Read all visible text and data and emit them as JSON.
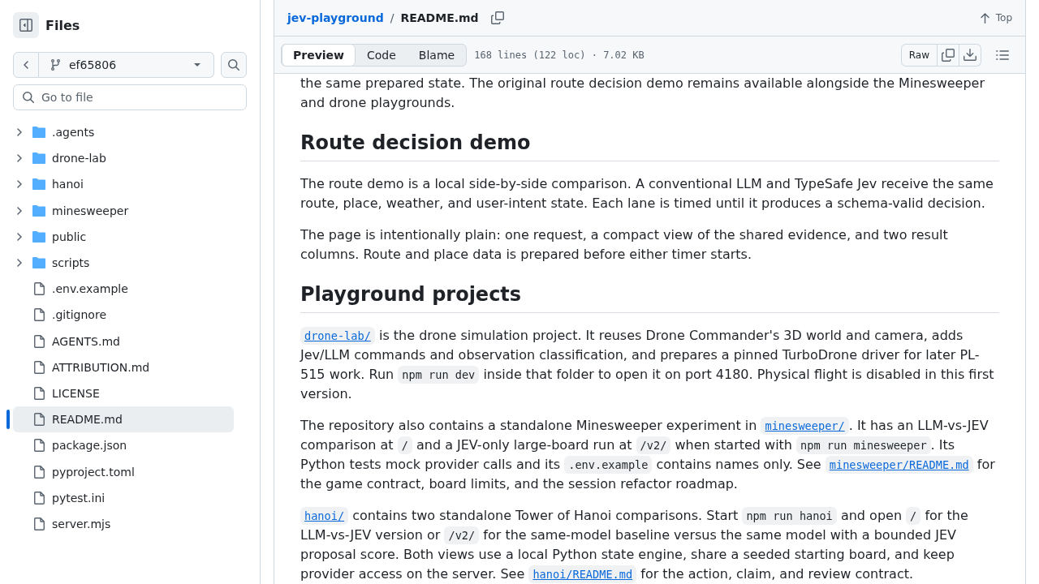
{
  "sidebar": {
    "title": "Files",
    "branch": "ef65806",
    "search": {
      "placeholder": "Go to file"
    },
    "tree": [
      {
        "name": ".agents",
        "kind": "folder",
        "expanded": false,
        "selected": false
      },
      {
        "name": "drone-lab",
        "kind": "folder",
        "expanded": false,
        "selected": false
      },
      {
        "name": "hanoi",
        "kind": "folder",
        "expanded": false,
        "selected": false
      },
      {
        "name": "minesweeper",
        "kind": "folder",
        "expanded": false,
        "selected": false
      },
      {
        "name": "public",
        "kind": "folder",
        "expanded": false,
        "selected": false
      },
      {
        "name": "scripts",
        "kind": "folder",
        "expanded": false,
        "selected": false
      },
      {
        "name": ".env.example",
        "kind": "file",
        "selected": false
      },
      {
        "name": ".gitignore",
        "kind": "file",
        "selected": false
      },
      {
        "name": "AGENTS.md",
        "kind": "file",
        "selected": false
      },
      {
        "name": "ATTRIBUTION.md",
        "kind": "file",
        "selected": false
      },
      {
        "name": "LICENSE",
        "kind": "file",
        "selected": false
      },
      {
        "name": "README.md",
        "kind": "file",
        "selected": true
      },
      {
        "name": "package.json",
        "kind": "file",
        "selected": false
      },
      {
        "name": "pyproject.toml",
        "kind": "file",
        "selected": false
      },
      {
        "name": "pytest.ini",
        "kind": "file",
        "selected": false
      },
      {
        "name": "server.mjs",
        "kind": "file",
        "selected": false
      }
    ]
  },
  "file": {
    "breadcrumb": {
      "repo": "jev-playground",
      "separator": "/",
      "file": "README.md"
    },
    "top": "Top",
    "view_tabs": [
      {
        "label": "Preview",
        "selected": true
      },
      {
        "label": "Code",
        "selected": false
      },
      {
        "label": "Blame",
        "selected": false
      }
    ],
    "stats": "168 lines (122 loc) · 7.02 KB",
    "raw": "Raw"
  },
  "readme": [
    {
      "kind": "paragraph",
      "parts": [
        {
          "kind": "text",
          "text": "the same prepared state. The original route decision demo remains available alongside the Minesweeper and drone playgrounds."
        }
      ]
    },
    {
      "kind": "heading",
      "text": "Route decision demo"
    },
    {
      "kind": "paragraph",
      "parts": [
        {
          "kind": "text",
          "text": "The route demo is a local side-by-side comparison. A conventional LLM and TypeSafe Jev receive the same route, place, weather, and user-intent state. Each lane is timed until it produces a schema-valid decision."
        }
      ]
    },
    {
      "kind": "paragraph",
      "parts": [
        {
          "kind": "text",
          "text": "The page is intentionally plain: one request, a compact view of the shared evidence, and two result columns. Route and place data is prepared before either timer starts."
        }
      ]
    },
    {
      "kind": "heading",
      "text": "Playground projects"
    },
    {
      "kind": "paragraph",
      "parts": [
        {
          "kind": "link",
          "text": "drone-lab/"
        },
        {
          "kind": "text",
          "text": " is the drone simulation project. It reuses Drone Commander's 3D world and camera, adds Jev/LLM commands and observation classification, and prepares a pinned TurboDrone driver for later PL-515 work. Run "
        },
        {
          "kind": "code",
          "text": "npm run dev"
        },
        {
          "kind": "text",
          "text": " inside that folder to open it on port 4180. Physical flight is disabled in this first version."
        }
      ]
    },
    {
      "kind": "paragraph",
      "parts": [
        {
          "kind": "text",
          "text": "The repository also contains a standalone Minesweeper experiment in "
        },
        {
          "kind": "link",
          "text": "minesweeper/"
        },
        {
          "kind": "text",
          "text": ". It has an LLM-vs-JEV comparison at "
        },
        {
          "kind": "code",
          "text": "/"
        },
        {
          "kind": "text",
          "text": " and a JEV-only large-board run at "
        },
        {
          "kind": "code",
          "text": "/v2/"
        },
        {
          "kind": "text",
          "text": " when started with "
        },
        {
          "kind": "code",
          "text": "npm run minesweeper"
        },
        {
          "kind": "text",
          "text": ". Its Python tests mock provider calls and its "
        },
        {
          "kind": "code",
          "text": ".env.example"
        },
        {
          "kind": "text",
          "text": " contains names only. See "
        },
        {
          "kind": "link",
          "text": "minesweeper/README.md"
        },
        {
          "kind": "text",
          "text": " for the game contract, board limits, and the session refactor roadmap."
        }
      ]
    },
    {
      "kind": "paragraph",
      "parts": [
        {
          "kind": "link",
          "text": "hanoi/"
        },
        {
          "kind": "text",
          "text": " contains two standalone Tower of Hanoi comparisons. Start "
        },
        {
          "kind": "code",
          "text": "npm run hanoi"
        },
        {
          "kind": "text",
          "text": " and open "
        },
        {
          "kind": "code",
          "text": "/"
        },
        {
          "kind": "text",
          "text": " for the LLM-vs-JEV version or "
        },
        {
          "kind": "code",
          "text": "/v2/"
        },
        {
          "kind": "text",
          "text": " for the same-model baseline versus the same model with a bounded JEV proposal score. Both views use a local Python state engine, share a seeded starting board, and keep provider access on the server. See "
        },
        {
          "kind": "link",
          "text": "hanoi/README.md"
        },
        {
          "kind": "text",
          "text": " for the action, claim, and review contract."
        }
      ]
    }
  ]
}
